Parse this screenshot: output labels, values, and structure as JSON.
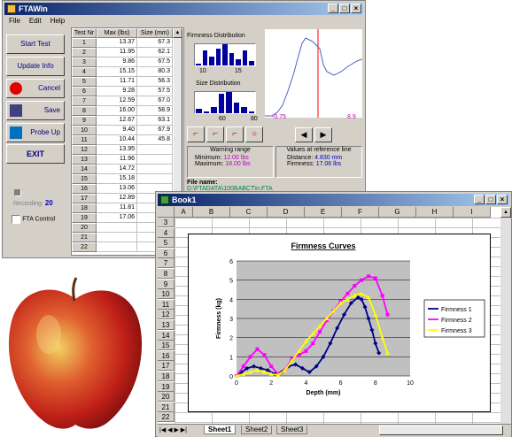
{
  "fta": {
    "title": "FTAWin",
    "menu": [
      "File",
      "Edit",
      "Help"
    ],
    "buttons": {
      "start": "Start Test",
      "update": "Update Info",
      "cancel": "Cancel",
      "save": "Save",
      "probe": "Probe Up",
      "exit": "EXIT"
    },
    "recording_label": "Recording:",
    "recording_value": "20",
    "fta_control": "FTA Control",
    "table_headers": [
      "Test Nr",
      "Max (lbs)",
      "Size (mm)"
    ],
    "rows": [
      [
        "1",
        "13.37",
        "67.3"
      ],
      [
        "2",
        "11.95",
        "62.1"
      ],
      [
        "3",
        "9.86",
        "67.5"
      ],
      [
        "4",
        "15.15",
        "80.3"
      ],
      [
        "5",
        "11.71",
        "56.3"
      ],
      [
        "6",
        "9.28",
        "57.5"
      ],
      [
        "7",
        "12.59",
        "67.0"
      ],
      [
        "8",
        "16.00",
        "58.9"
      ],
      [
        "9",
        "12.67",
        "63.1"
      ],
      [
        "10",
        "9.40",
        "67.9"
      ],
      [
        "11",
        "10.44",
        "45.8"
      ],
      [
        "12",
        "13.95",
        ""
      ],
      [
        "13",
        "11.96",
        ""
      ],
      [
        "14",
        "14.72",
        ""
      ],
      [
        "15",
        "15.18",
        ""
      ],
      [
        "16",
        "13.06",
        ""
      ],
      [
        "17",
        "12.89",
        ""
      ],
      [
        "18",
        "11.81",
        ""
      ],
      [
        "19",
        "17.06",
        ""
      ],
      [
        "20",
        "",
        ""
      ],
      [
        "21",
        "",
        ""
      ],
      [
        "22",
        "",
        ""
      ]
    ],
    "firmness_dist": {
      "title": "Firmness Distribution",
      "count": "20",
      "ticks": [
        "10",
        "15"
      ],
      "bars": [
        0.1,
        0.7,
        0.4,
        0.8,
        1.0,
        0.6,
        0.3,
        0.7,
        0.2
      ]
    },
    "size_dist": {
      "title": "Size Distribution",
      "ticks": [
        "60",
        "80"
      ],
      "bars": [
        0.2,
        0.1,
        0.3,
        0.9,
        1.0,
        0.5,
        0.3,
        0.1
      ]
    },
    "curve_axis": {
      "left": "-0.75",
      "right": "8.9"
    },
    "warning": {
      "title": "Warning range",
      "min_label": "Minimum:",
      "min_value": "12.00 lbs",
      "max_label": "Maximum:",
      "max_value": "18.00 lbs"
    },
    "reference": {
      "title": "Values at reference line",
      "dist_label": "Distance:",
      "dist_value": "4.830 mm",
      "firm_label": "Firmness:",
      "firm_value": "17.06 lbs"
    },
    "file_label": "File name:",
    "file_value": "D:\\FTADATA\\100BABCT\\n.FTA"
  },
  "excel": {
    "title": "Book1",
    "columns": [
      "A",
      "B",
      "C",
      "D",
      "E",
      "F",
      "G",
      "H",
      "I"
    ],
    "rows": [
      "3",
      "4",
      "5",
      "6",
      "7",
      "8",
      "9",
      "10",
      "11",
      "12",
      "13",
      "14",
      "15",
      "16",
      "17",
      "18",
      "19",
      "20",
      "21",
      "22"
    ],
    "sheets": [
      "Sheet1",
      "Sheet2",
      "Sheet3"
    ]
  },
  "chart_data": {
    "type": "line",
    "title": "Firmness Curves",
    "xlabel": "Depth (mm)",
    "ylabel": "Firmness (kg)",
    "xlim": [
      0,
      10
    ],
    "ylim": [
      0,
      6
    ],
    "xticks": [
      "0",
      "2",
      "4",
      "6",
      "8",
      "10"
    ],
    "yticks": [
      "0",
      "1",
      "2",
      "3",
      "4",
      "5",
      "6"
    ],
    "grid": true,
    "legend": "right",
    "series": [
      {
        "name": "Firmness 1",
        "color": "#000080",
        "marker": "diamond",
        "x": [
          0,
          0.3,
          0.6,
          1.0,
          1.4,
          1.8,
          2.2,
          2.6,
          3.0,
          3.4,
          3.8,
          4.2,
          4.6,
          5.0,
          5.4,
          5.8,
          6.2,
          6.6,
          7.0,
          7.2,
          7.4,
          7.6,
          7.8,
          8.0,
          8.2
        ],
        "y": [
          0,
          0.2,
          0.4,
          0.5,
          0.4,
          0.3,
          0.1,
          0.2,
          0.5,
          0.6,
          0.4,
          0.2,
          0.5,
          1.0,
          1.7,
          2.5,
          3.2,
          3.8,
          4.1,
          4.0,
          3.6,
          3.0,
          2.4,
          1.7,
          1.2
        ]
      },
      {
        "name": "Firmness 2",
        "color": "#ff00ff",
        "marker": "square",
        "x": [
          0,
          0.4,
          0.8,
          1.2,
          1.6,
          2.0,
          2.4,
          2.8,
          3.2,
          3.6,
          4.0,
          4.4,
          4.8,
          5.2,
          5.6,
          6.0,
          6.4,
          6.8,
          7.2,
          7.6,
          8.0,
          8.4,
          8.7
        ],
        "y": [
          0,
          0.5,
          1.0,
          1.4,
          1.1,
          0.5,
          0.1,
          0.3,
          0.9,
          1.1,
          1.3,
          1.7,
          2.3,
          2.9,
          3.4,
          3.9,
          4.3,
          4.7,
          5.0,
          5.2,
          5.1,
          4.2,
          3.2
        ]
      },
      {
        "name": "Firmness 3",
        "color": "#ffff00",
        "marker": "triangle",
        "x": [
          0,
          0.4,
          0.8,
          1.2,
          1.6,
          2.0,
          2.4,
          2.8,
          3.2,
          3.6,
          4.0,
          4.4,
          4.8,
          5.2,
          5.6,
          6.0,
          6.4,
          6.8,
          7.2,
          7.6,
          8.0,
          8.4,
          8.7
        ],
        "y": [
          0,
          0.1,
          0.2,
          0.3,
          0.2,
          0.1,
          0.05,
          0.3,
          0.8,
          1.3,
          1.8,
          2.2,
          2.6,
          3.0,
          3.4,
          3.8,
          4.0,
          4.2,
          4.3,
          4.1,
          3.2,
          2.0,
          1.2
        ]
      }
    ]
  }
}
